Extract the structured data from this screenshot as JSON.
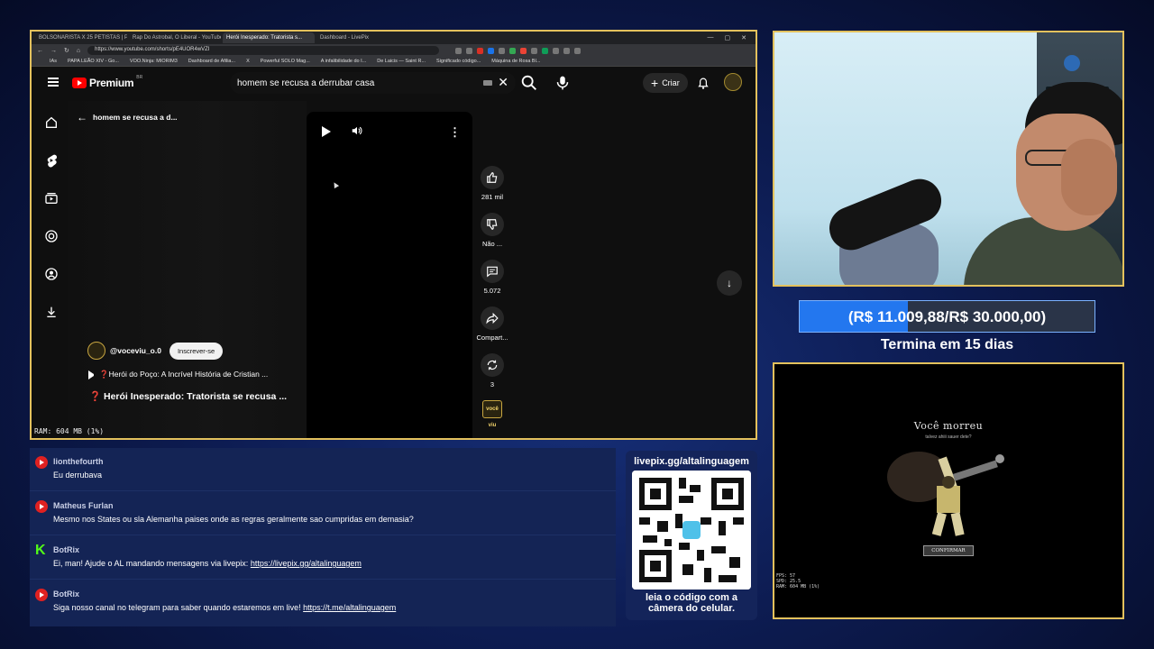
{
  "browser": {
    "tabs": [
      {
        "label": "BOLSONARISTA X 25 PETISTAS | P..."
      },
      {
        "label": "Rap Do Astrobal, O Liberal - YouTube"
      },
      {
        "label": "Herói Inesperado: Tratorista s..."
      },
      {
        "label": "Dashboard - LivePix"
      }
    ],
    "url": "https://www.youtube.com/shorts/pE4UOR4wVZI",
    "bookmarks": [
      "IAs",
      "PAPA LEÃO XIV - Go...",
      "VOO.Ninja: MIORIM3",
      "Dashboard de Afilia...",
      "X",
      "Powerful SOLO Mag...",
      "A infalibilidade do I...",
      "De Laicis — Saint R...",
      "Significado código...",
      "Máquina de Rosa Bl..."
    ]
  },
  "youtube": {
    "logo_text": "Premium",
    "logo_sup": "BR",
    "search_value": "homem se recusa a derrubar casa",
    "create_label": "Criar",
    "back_label": "homem se recusa a d...",
    "channel": "@voceviu_o.0",
    "subscribe_label": "Inscrever-se",
    "playlist_title": "❓Herói do Poço: A Incrível História de Cristian ...",
    "video_title": "❓ Herói Inesperado: Tratorista se recusa ...",
    "likes": "281 mil",
    "dislike_label": "Não ...",
    "comments": "5.072",
    "share_label": "Compart...",
    "remix_count": "3",
    "channel_badge": "você viu",
    "ram_overlay": "RAM: 604 MB (1%)"
  },
  "stream": {
    "goal_text": "(R$ 11.009,88/R$ 30.000,00)",
    "goal_fraction": 0.367,
    "ends_text": "Termina em 15 dias",
    "game_title": "Você morreu",
    "game_subtitle": "talvez ahiii sauer dete?",
    "game_button": "CONFIRMAR",
    "game_stats": "FPS: 57\nSPD: 25.5\nRAM: 604 MB (1%)",
    "qr_top": "livepix.gg/altalinguagem",
    "qr_bottom_1": "leia o código com a",
    "qr_bottom_2": "câmera do celular."
  },
  "chat": [
    {
      "platform": "youtube",
      "user": "lionthefourth",
      "text": "Eu derrubava",
      "link": ""
    },
    {
      "platform": "youtube",
      "user": "Matheus Furlan",
      "text": "Mesmo nos States ou sla Alemanha paises onde as regras geralmente sao cumpridas em demasia?",
      "link": ""
    },
    {
      "platform": "kick",
      "user": "BotRix",
      "text": "Ei, man! Ajude o AL mandando mensagens via livepix: ",
      "link": "https://livepix.gg/altalinguagem"
    },
    {
      "platform": "youtube",
      "user": "BotRix",
      "text": "Siga nosso canal no telegram para saber quando estaremos em live! ",
      "link": "https://t.me/altalinguagem"
    }
  ],
  "colors": {
    "accent_gold": "#e3c15d",
    "youtube_red": "#ff0000",
    "kick_green": "#53fc18",
    "goal_blue": "#2377ef"
  }
}
